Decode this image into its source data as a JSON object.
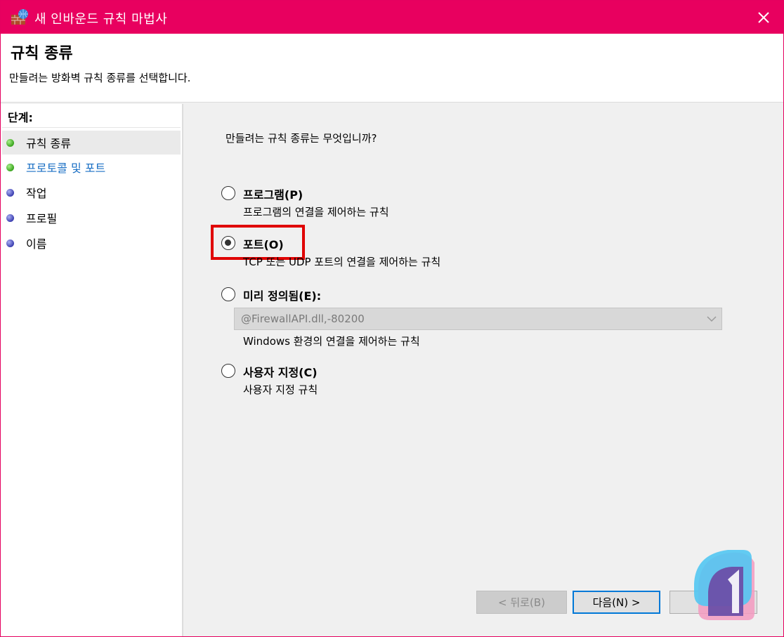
{
  "window": {
    "title": "새 인바운드 규칙 마법사",
    "title_icon": "firewall-icon",
    "close_icon": "close-icon",
    "accent_color": "#e8005f"
  },
  "header": {
    "title": "규칙 종류",
    "description": "만들려는 방화벽 규칙 종류를 선택합니다."
  },
  "sidebar": {
    "steps_label": "단계:",
    "items": [
      {
        "label": "규칙 종류",
        "status": "green"
      },
      {
        "label": "프로토콜 및 포트",
        "status": "green"
      },
      {
        "label": "작업",
        "status": "blue"
      },
      {
        "label": "프로필",
        "status": "blue"
      },
      {
        "label": "이름",
        "status": "blue"
      }
    ]
  },
  "main": {
    "question": "만들려는 규칙 종류는 무엇입니까?",
    "options": [
      {
        "label": "프로그램(P)",
        "description": "프로그램의 연결을 제어하는 규칙",
        "checked": false
      },
      {
        "label": "포트(O)",
        "description": "TCP 또는 UDP 포트의 연결을 제어하는 규칙",
        "checked": true
      },
      {
        "label": "미리 정의됨(E):",
        "description": "Windows 환경의 연결을 제어하는 규칙",
        "checked": false
      },
      {
        "label": "사용자 지정(C)",
        "description": "사용자 지정 규칙",
        "checked": false
      }
    ],
    "predefined_select": {
      "value": "@FirewallAPI.dll,-80200",
      "disabled": true
    },
    "highlight_color": "#e00000"
  },
  "footer": {
    "back_label": "< 뒤로(B)",
    "next_label": "다음(N) >",
    "cancel_label": ""
  }
}
